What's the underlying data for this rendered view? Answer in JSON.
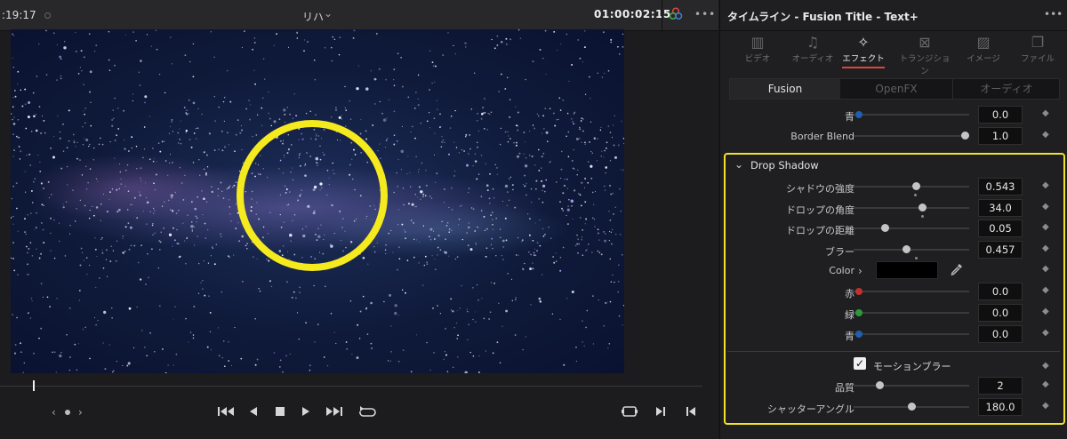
{
  "viewer": {
    "timecode_left": ":19:17",
    "clip_name": "リハ",
    "timecode_right": "01:00:02:15",
    "more": "•••"
  },
  "transport": {
    "prev": "‹",
    "next": "›"
  },
  "inspector": {
    "title": "タイムライン - Fusion Title - Text+",
    "more": "•••",
    "panel_tabs": [
      {
        "label": "ビデオ",
        "icon": "film-icon",
        "active": false
      },
      {
        "label": "オーディオ",
        "icon": "music-note-icon",
        "active": false
      },
      {
        "label": "エフェクト",
        "icon": "magic-wand-icon",
        "active": true
      },
      {
        "label": "トランジション",
        "icon": "transition-icon",
        "active": false
      },
      {
        "label": "イメージ",
        "icon": "image-icon",
        "active": false
      },
      {
        "label": "ファイル",
        "icon": "file-icon",
        "active": false
      }
    ],
    "sub_tabs": [
      {
        "label": "Fusion",
        "active": true
      },
      {
        "label": "OpenFX",
        "active": false
      },
      {
        "label": "オーディオ",
        "active": false
      }
    ],
    "above": [
      {
        "label": "青",
        "value": "0.0",
        "type": "color-channel",
        "color": "#1f5fb0"
      },
      {
        "label": "Border Blend",
        "value": "1.0",
        "type": "slider",
        "level": 1.0
      }
    ],
    "drop_shadow": {
      "header": "Drop Shadow",
      "params": [
        {
          "label": "シャドウの強度",
          "value": "0.543",
          "type": "slider",
          "level": 0.543
        },
        {
          "label": "ドロップの角度",
          "value": "34.0",
          "type": "slider",
          "level": 0.6
        },
        {
          "label": "ドロップの距離",
          "value": "0.05",
          "type": "slider",
          "level": 0.3
        },
        {
          "label": "ブラー",
          "value": "0.457",
          "type": "slider",
          "level": 0.457
        },
        {
          "label": "Color",
          "type": "color"
        },
        {
          "label": "赤",
          "value": "0.0",
          "type": "color-channel",
          "color": "#c0322d"
        },
        {
          "label": "緑",
          "value": "0.0",
          "type": "color-channel",
          "color": "#2d9a3a"
        },
        {
          "label": "青",
          "value": "0.0",
          "type": "color-channel",
          "color": "#1f5fb0"
        }
      ],
      "swatch_color": "#000000"
    },
    "motion_blur": {
      "label": "モーションブラー",
      "checked": true,
      "params": [
        {
          "label": "品質",
          "value": "2",
          "type": "slider",
          "level": 0.24
        },
        {
          "label": "シャッターアングル",
          "value": "180.0",
          "type": "slider",
          "level": 0.5
        }
      ]
    }
  },
  "colors": {
    "highlight": "#f1e22c",
    "accent_tab": "#d9473b"
  }
}
